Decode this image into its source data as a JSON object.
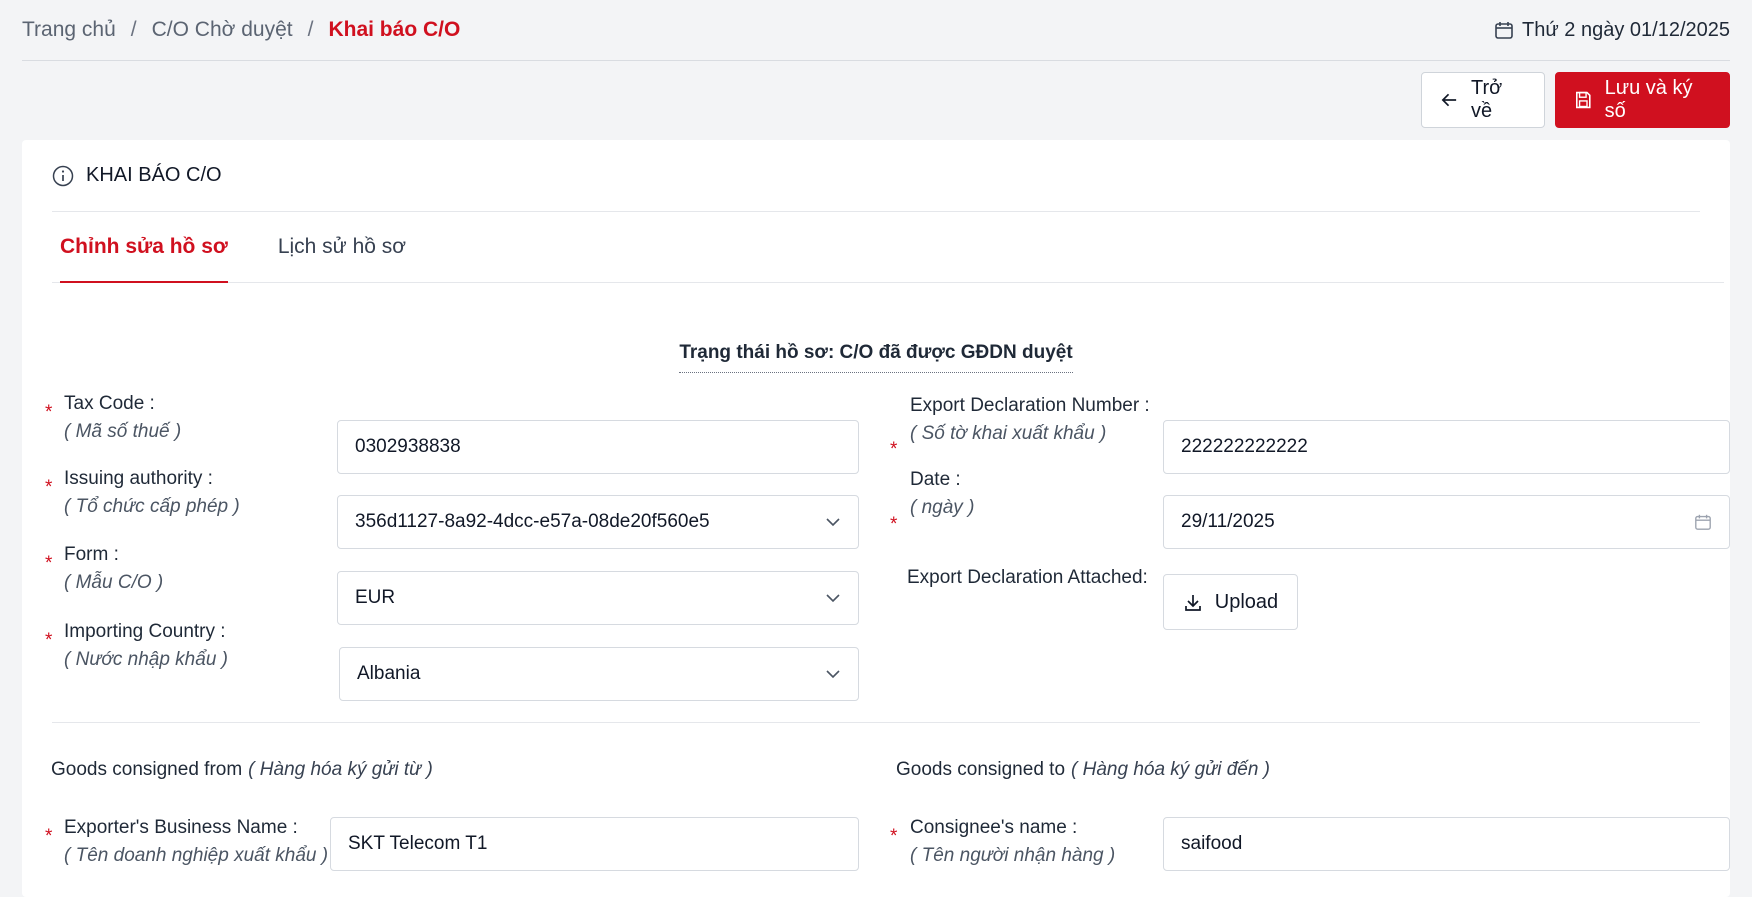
{
  "breadcrumb": {
    "home": "Trang chủ",
    "pending": "C/O Chờ duyệt",
    "current": "Khai báo C/O"
  },
  "date_text": "Thứ 2 ngày 01/12/2025",
  "actions": {
    "back": "Trở về",
    "save": "Lưu và ký số"
  },
  "card": {
    "title": "KHAI BÁO C/O"
  },
  "tabs": [
    {
      "label": "Chỉnh sửa hồ sơ",
      "active": true
    },
    {
      "label": "Lịch sử hồ sơ",
      "active": false
    }
  ],
  "status_text": "Trạng thái hồ sơ: C/O đã được GĐDN duyệt",
  "fields": {
    "tax_code": {
      "label": "Tax Code :",
      "vi": "( Mã số thuế )",
      "value": "0302938838"
    },
    "issuing_authority": {
      "label": "Issuing authority :",
      "vi": "( Tổ chức cấp phép )",
      "value": "356d1127-8a92-4dcc-e57a-08de20f560e5"
    },
    "form": {
      "label": "Form :",
      "vi": "( Mẫu C/O )",
      "value": "EUR"
    },
    "importing_country": {
      "label": "Importing Country :",
      "vi": "( Nước nhập khẩu )",
      "value": "Albania"
    },
    "export_declaration_number": {
      "label": "Export Declaration Number :",
      "vi": "( Số tờ khai xuất khẩu )",
      "value": "222222222222"
    },
    "date": {
      "label": "Date :",
      "vi": "( ngày )",
      "value": "29/11/2025"
    },
    "export_declaration_attached": {
      "label": "Export Declaration Attached:",
      "button": "Upload"
    }
  },
  "sections": {
    "from": {
      "title": "Goods consigned from",
      "vi": "( Hàng hóa ký gửi từ )"
    },
    "to": {
      "title": "Goods consigned to",
      "vi": "( Hàng hóa ký gửi đến )"
    }
  },
  "consign_fields": {
    "exporter": {
      "label": "Exporter's Business Name :",
      "vi": "( Tên doanh nghiệp xuất khẩu )",
      "value": "SKT Telecom T1"
    },
    "consignee": {
      "label": "Consignee's name :",
      "vi": "( Tên người nhận hàng )",
      "value": "saifood"
    }
  },
  "required_mark": "*",
  "colors": {
    "accent": "#d0101f",
    "border": "#d6dae0",
    "background": "#f3f4f6"
  }
}
